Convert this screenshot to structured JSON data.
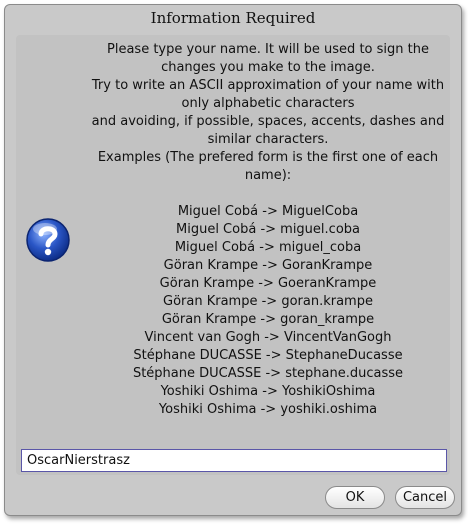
{
  "dialog": {
    "title": "Information Required",
    "message_lines": [
      "Please type your name. It will be used to sign the",
      "changes you make to the image.",
      "Try to write an ASCII approximation of your name with",
      "only alphabetic characters",
      "and avoiding, if possible, spaces, accents, dashes and",
      "similar characters.",
      "Examples (The prefered form is the first one of each",
      "name):"
    ],
    "examples": [
      "Miguel Cobá -> MiguelCoba",
      "Miguel Cobá -> miguel.coba",
      "Miguel Cobá -> miguel_coba",
      "Göran Krampe -> GoranKrampe",
      "Göran Krampe -> GoeranKrampe",
      "Göran Krampe -> goran.krampe",
      "Göran Krampe -> goran_krampe",
      "Vincent van Gogh -> VincentVanGogh",
      "Stéphane DUCASSE -> StephaneDucasse",
      "Stéphane DUCASSE -> stephane.ducasse",
      "Yoshiki Oshima -> YoshikiOshima",
      "Yoshiki Oshima -> yoshiki.oshima"
    ],
    "input_value": "OscarNierstrasz",
    "ok_label": "OK",
    "cancel_label": "Cancel",
    "icon": "question-icon",
    "colors": {
      "dialog_bg": "#c9c9c9",
      "icon_blue": "#2a56c6",
      "input_border": "#5a56a8"
    }
  }
}
